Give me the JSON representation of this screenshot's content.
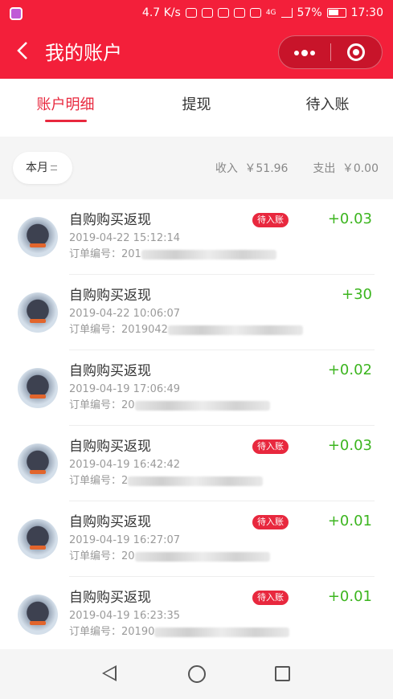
{
  "status_bar": {
    "speed": "4.7 K/s",
    "network": "4G",
    "battery": "57%",
    "time": "17:30"
  },
  "header": {
    "back_icon": "chevron-left-icon",
    "title": "我的账户",
    "more_icon": "more-dots-icon",
    "close_icon": "target-close-icon"
  },
  "tabs": [
    {
      "label": "账户明细",
      "active": true
    },
    {
      "label": "提现",
      "active": false
    },
    {
      "label": "待入账",
      "active": false
    }
  ],
  "filter": {
    "month_label": "本月",
    "income_label": "收入",
    "income_value": "￥51.96",
    "expense_label": "支出",
    "expense_value": "￥0.00"
  },
  "transactions": [
    {
      "title": "自购购买返现",
      "time": "2019-04-22 15:12:14",
      "order_label": "订单编号：",
      "order_prefix": "201",
      "badge": "待入账",
      "amount": "+0.03"
    },
    {
      "title": "自购购买返现",
      "time": "2019-04-22 10:06:07",
      "order_label": "订单编号：",
      "order_prefix": "2019042",
      "badge": "",
      "amount": "+30"
    },
    {
      "title": "自购购买返现",
      "time": "2019-04-19 17:06:49",
      "order_label": "订单编号：",
      "order_prefix": "20",
      "badge": "",
      "amount": "+0.02"
    },
    {
      "title": "自购购买返现",
      "time": "2019-04-19 16:42:42",
      "order_label": "订单编号：",
      "order_prefix": "2",
      "badge": "待入账",
      "amount": "+0.03"
    },
    {
      "title": "自购购买返现",
      "time": "2019-04-19 16:27:07",
      "order_label": "订单编号：",
      "order_prefix": "20",
      "badge": "待入账",
      "amount": "+0.01"
    },
    {
      "title": "自购购买返现",
      "time": "2019-04-19 16:23:35",
      "order_label": "订单编号：",
      "order_prefix": "20190",
      "badge": "待入账",
      "amount": "+0.01"
    }
  ],
  "colors": {
    "brand_red": "#f31f3a",
    "income_green": "#3cb51f"
  },
  "system_nav": {
    "back_icon": "nav-back-icon",
    "home_icon": "nav-home-icon",
    "recent_icon": "nav-recent-icon"
  }
}
